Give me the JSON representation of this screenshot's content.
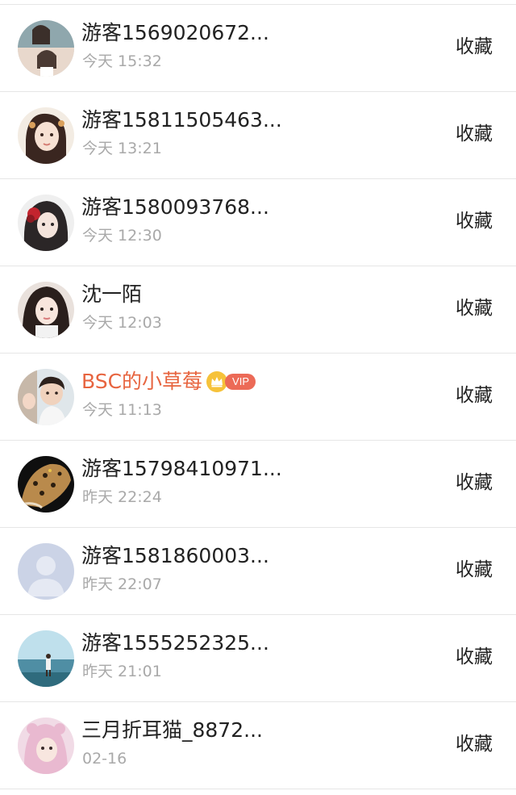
{
  "rows": [
    {
      "name": "游客1569020672...",
      "time": "今天 15:32",
      "action": "收藏",
      "avatar": "avatar-icon"
    },
    {
      "name": "游客15811505463...",
      "time": "今天 13:21",
      "action": "收藏",
      "avatar": "avatar-icon"
    },
    {
      "name": "游客1580093768...",
      "time": "今天 12:30",
      "action": "收藏",
      "avatar": "avatar-icon"
    },
    {
      "name": "沈一陌",
      "time": "今天 12:03",
      "action": "收藏",
      "avatar": "avatar-icon"
    },
    {
      "name": "BSC的小草莓",
      "time": "今天 11:13",
      "action": "收藏",
      "avatar": "avatar-icon",
      "vip_label": "VIP",
      "badge_icon": "crown-icon"
    },
    {
      "name": "游客15798410971...",
      "time": "昨天 22:24",
      "action": "收藏",
      "avatar": "avatar-icon"
    },
    {
      "name": "游客1581860003...",
      "time": "昨天 22:07",
      "action": "收藏",
      "avatar": "default-avatar-icon"
    },
    {
      "name": "游客1555252325...",
      "time": "昨天 21:01",
      "action": "收藏",
      "avatar": "avatar-icon"
    },
    {
      "name": "三月折耳猫_8872...",
      "time": "02-16",
      "action": "收藏",
      "avatar": "avatar-icon"
    }
  ],
  "colors": {
    "name": "#222222",
    "vip_name": "#e7643f",
    "time": "#a9a9a9",
    "vip_badge": "#ec6a57",
    "divider": "#e6e6e6"
  }
}
